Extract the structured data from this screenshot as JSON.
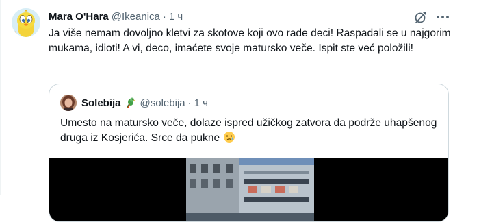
{
  "author": {
    "display_name": "Mara O'Hara",
    "handle": "@Ikeanica",
    "separator": "·",
    "time": "1 ч",
    "avatar_icon": "tweety-bird-avatar"
  },
  "tweet": {
    "text": "Ja više nemam dovoljno kletvi za skotove koji ovo rade deci! Raspadali se u najgorim mukama, idioti! A vi, deco, imaćete svoje matursko veče. Ispit ste već položili!"
  },
  "actions": {
    "grok_icon": "grok-icon",
    "more_icon": "more-options-icon"
  },
  "quoted": {
    "display_name": "Solebija",
    "badge_icon": "parrot-emoji",
    "handle": "@solebija",
    "separator": "·",
    "time": "1 ч",
    "text": "Umesto na matursko veče, dolaze ispred užičkog zatvora da podrže uhapšenog druga iz Kosjerića. Srce da pukne",
    "trailing_emoji": "crying-face-emoji",
    "media_icon": "video-thumbnail"
  },
  "colors": {
    "text_primary": "#0f1419",
    "text_secondary": "#536471",
    "border": "#cfd9de"
  }
}
